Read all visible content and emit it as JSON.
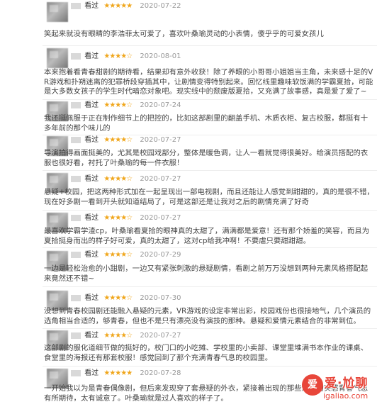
{
  "colors": {
    "star": "#f0a61b",
    "date": "#999999",
    "watermark": "#e8463a"
  },
  "icons": {
    "avatar": "blurred-avatar-icon",
    "star": "star-icon"
  },
  "reviews": [
    {
      "action": "看过",
      "stars": "★★★★★",
      "date": "2020-07-22",
      "text": "笑起来就没有眼睛的李浩菲太可爱了，喜欢叶桑瑜灵动的小表情，傻乎乎的可爱女孩儿"
    },
    {
      "action": "看过",
      "stars": "★★★★☆",
      "date": "2020-08-01",
      "text": "本来抱着看青春甜剧的期待看，结果却有意外收获！除了养眼的小哥哥小姐姐当主角，未来感十足的VR游戏和扑朔迷离的犯罪桥段穿插其中，让剧情变得特别起来。回忆线里趣味软饭满的学霸夏拾，可能是大多数女孩子的学生时代暗恋对象吧。现实线中的颓废版夏拾，又充满了故事感，真是爱了爱了~"
    },
    {
      "action": "看过",
      "stars": "★★★★☆",
      "date": "2020-07-24",
      "text": "我还挺佩服于正在制作细节上的把控的，比如这部剧里的翻盖手机、木质衣柜、复古校服，都挺有十多年前的那个味儿的"
    },
    {
      "action": "看过",
      "stars": "★★★★☆",
      "date": "2020-07-27",
      "text": "导演拍得画面挺美的，尤其是校园戏部分，整体是暖色调，让人一看就觉得很美好。给演员搭配的衣服也很好看，衬托了叶桑瑜的每一件衣服！"
    },
    {
      "action": "看过",
      "stars": "★★★★☆",
      "date": "2020-07-27",
      "text": "悬疑+校园，把这两种形式加在一起呈现出一部电视剧，而且还能让人感觉到甜甜的，真的是很不错，现在好多剧一看到开头就知道结局了，可是这部还是让我对之后的剧情充满了好奇"
    },
    {
      "action": "看过",
      "stars": "★★★★☆",
      "date": "2020-07-27",
      "text": "最喜欢学霸学渣cp，叶桑瑜看夏拾的眼神真的太甜了，满满都是爱意！还有那个娇羞的笑容，而且为夏拾挺身而出的样子好可爱，真的太甜了，这对cp给我冲啊！不要虐只要甜甜甜。"
    },
    {
      "action": "看过",
      "stars": "★★★★☆",
      "date": "2020-07-29",
      "text": "一边是轻松治愈的小甜剧，一边又有紧张刺激的悬疑剧情，看剧之前万万没想到两种元素风格搭配起来竟然还不错~"
    },
    {
      "action": "看过",
      "stars": "★★★★☆",
      "date": "2020-07-30",
      "text": "没想到青春校园剧还能融入悬疑的元素，VR游戏的设定非常出彩，校园戏份也很接地气，几个演员的选角相当合适的，够青春，但也不是只有漂亮没有演技的那种。悬疑和爱情元素结合的非常到位。"
    },
    {
      "action": "看过",
      "stars": "★★★★☆",
      "date": "2020-07-27",
      "text": "这部剧的服化道细节做的挺好的，校门口的小吃摊、学校里的小卖部、课堂里堆满书本作业的课桌、食堂里的海报还有那套校服！感觉回到了那个充满青春气息的校园里。"
    },
    {
      "action": "看过",
      "stars": "★★★★★",
      "date": "2020-07-28",
      "text": "一开始我以为是青春偶像剧，但后来发现穿了套悬疑的外衣，紧接着出现的那些满满的实感青春气息有所期待，太有诚意了。叶桑瑜就是过人喜欢的样子了。"
    }
  ],
  "watermark": {
    "badge": "爱",
    "title": "爱·尬聊",
    "url": "igaliao.com"
  }
}
